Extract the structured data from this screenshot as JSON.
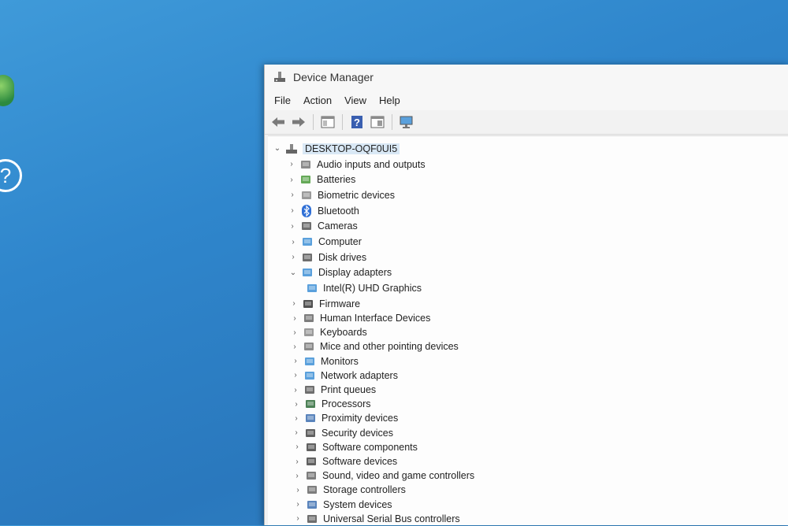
{
  "window": {
    "title": "Device Manager"
  },
  "menu": [
    "File",
    "Action",
    "View",
    "Help"
  ],
  "toolbar": [
    {
      "icon": "back-arrow-icon"
    },
    {
      "icon": "forward-arrow-icon"
    },
    {
      "icon": "properties-icon"
    },
    {
      "icon": "help-icon"
    },
    {
      "icon": "update-driver-icon"
    },
    {
      "icon": "scan-hardware-icon"
    }
  ],
  "tree": {
    "root": "DESKTOP-OQF0UI5",
    "categories": [
      {
        "label": "Audio inputs and outputs",
        "icon": "speaker-icon",
        "expanded": false
      },
      {
        "label": "Batteries",
        "icon": "battery-icon",
        "expanded": false
      },
      {
        "label": "Biometric devices",
        "icon": "fingerprint-icon",
        "expanded": false
      },
      {
        "label": "Bluetooth",
        "icon": "bluetooth-icon",
        "expanded": false
      },
      {
        "label": "Cameras",
        "icon": "camera-icon",
        "expanded": false
      },
      {
        "label": "Computer",
        "icon": "computer-icon",
        "expanded": false
      },
      {
        "label": "Disk drives",
        "icon": "disk-drive-icon",
        "expanded": false
      },
      {
        "label": "Display adapters",
        "icon": "display-adapter-icon",
        "expanded": true
      },
      {
        "label": "Intel(R) UHD Graphics",
        "icon": "display-adapter-icon",
        "child": true
      },
      {
        "label": "Firmware",
        "icon": "firmware-icon",
        "expanded": false
      },
      {
        "label": "Human Interface Devices",
        "icon": "hid-icon",
        "expanded": false
      },
      {
        "label": "Keyboards",
        "icon": "keyboard-icon",
        "expanded": false
      },
      {
        "label": "Mice and other pointing devices",
        "icon": "mouse-icon",
        "expanded": false
      },
      {
        "label": "Monitors",
        "icon": "monitor-icon",
        "expanded": false
      },
      {
        "label": "Network adapters",
        "icon": "network-adapter-icon",
        "expanded": false
      },
      {
        "label": "Print queues",
        "icon": "printer-icon",
        "expanded": false
      },
      {
        "label": "Processors",
        "icon": "processor-icon",
        "expanded": false
      },
      {
        "label": "Proximity devices",
        "icon": "proximity-icon",
        "expanded": false
      },
      {
        "label": "Security devices",
        "icon": "security-icon",
        "expanded": false
      },
      {
        "label": "Software components",
        "icon": "software-component-icon",
        "expanded": false
      },
      {
        "label": "Software devices",
        "icon": "software-device-icon",
        "expanded": false
      },
      {
        "label": "Sound, video and game controllers",
        "icon": "sound-controller-icon",
        "expanded": false
      },
      {
        "label": "Storage controllers",
        "icon": "storage-controller-icon",
        "expanded": false
      },
      {
        "label": "System devices",
        "icon": "system-device-icon",
        "expanded": false
      },
      {
        "label": "Universal Serial Bus controllers",
        "icon": "usb-icon",
        "expanded": false
      }
    ]
  },
  "colors": {
    "desktop": "#2f86cc",
    "selection": "#d9e8f5"
  }
}
